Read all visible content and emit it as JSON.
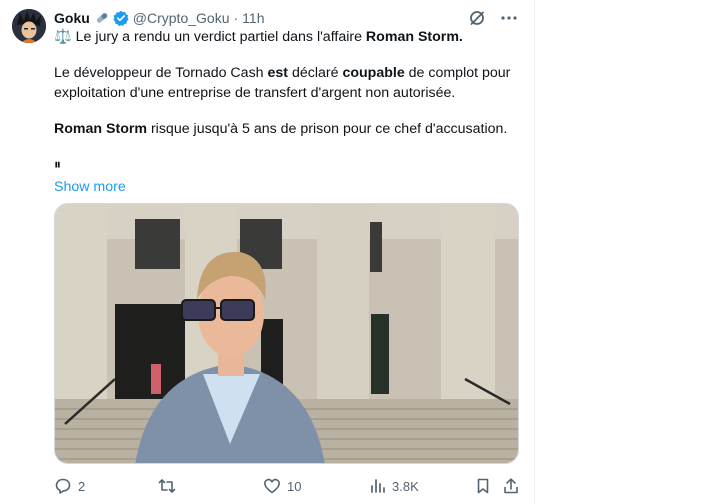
{
  "tweet": {
    "author_name": "Goku",
    "handle": "@Crypto_Goku",
    "separator": "·",
    "time": "11h",
    "line1_emoji": "⚖️",
    "line1_text": " Le jury a rendu un verdict partiel dans l'affaire ",
    "line1_bold": "Roman Storm.",
    "p2_l1_a": "Le développeur de Tornado Cash ",
    "p2_l1_b": "est",
    "p2_l1_c": " déclaré ",
    "p2_l1_d": "coupable",
    "p2_l1_e": " de complot pour",
    "p2_l2": "exploitation d'une entreprise de transfert d'argent non autorisée.",
    "p3_bold": "Roman Storm",
    "p3_rest": " risque jusqu'à 5 ans de prison pour ce chef d'accusation.",
    "pause_glyph": "⏸",
    "show_more": "Show more"
  },
  "actions": {
    "replies": "2",
    "reposts": "",
    "likes": "10",
    "views": "3.8K"
  },
  "colors": {
    "accent": "#1d9bf0",
    "text": "#0f1419",
    "muted": "#536471",
    "grok_icon": "#536471"
  },
  "icons": [
    "pill-icon",
    "verified-badge-icon",
    "grok-icon",
    "more-icon",
    "reply-icon",
    "repost-icon",
    "like-icon",
    "views-icon",
    "bookmark-icon",
    "share-icon"
  ]
}
